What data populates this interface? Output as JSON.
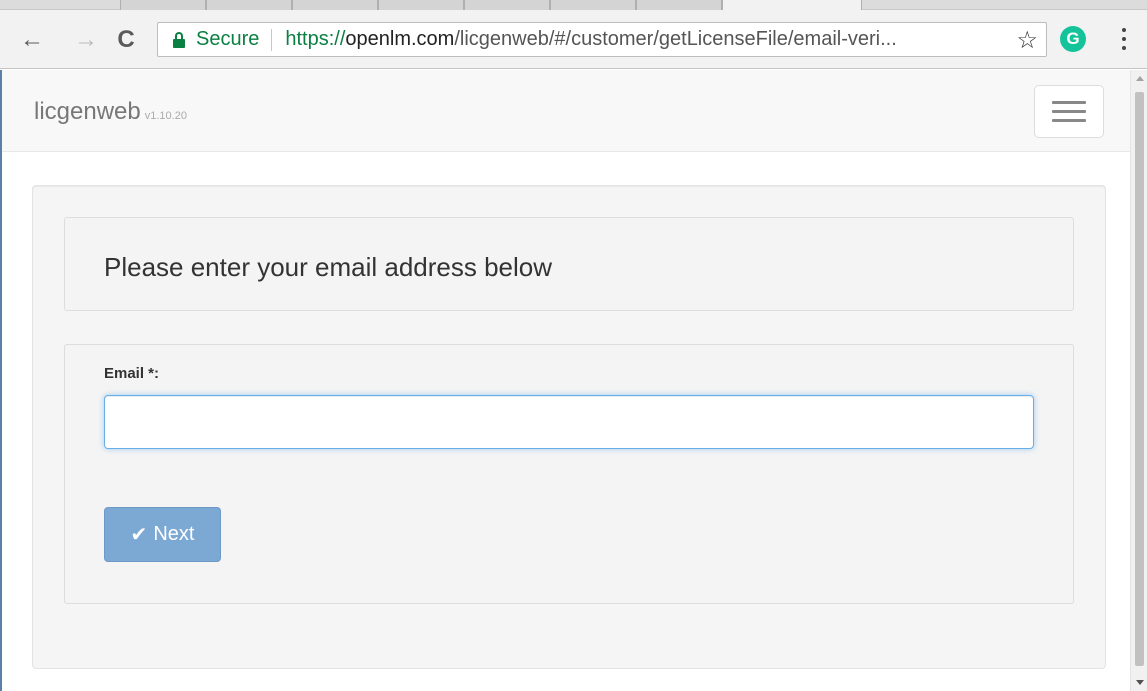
{
  "browser": {
    "nav": {
      "back_icon": "←",
      "forward_icon": "→",
      "reload_icon": "C"
    },
    "address_bar": {
      "security_label": "Secure",
      "url_scheme": "https://",
      "url_host": "openlm.com",
      "url_path": "/licgenweb/#/customer/getLicenseFile/email-veri..."
    },
    "bookmark_icon": "☆",
    "extension_icon": "G"
  },
  "app": {
    "brand": "licgenweb",
    "version": "v1.10.20"
  },
  "form": {
    "heading": "Please enter your email address below",
    "email_label": "Email *:",
    "email_value": "",
    "next_label": "Next",
    "next_icon": "✔"
  },
  "colors": {
    "secure_green": "#0b8043",
    "focus_blue": "#66afe9",
    "button_blue": "#7ca8d4"
  }
}
